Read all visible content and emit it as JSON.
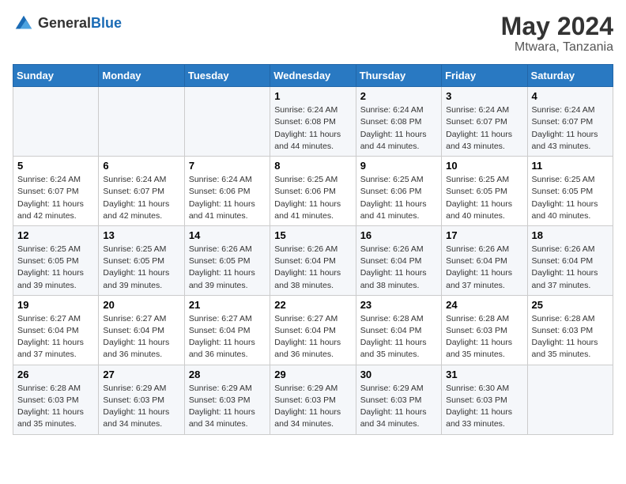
{
  "header": {
    "logo_general": "General",
    "logo_blue": "Blue",
    "main_title": "May 2024",
    "sub_title": "Mtwara, Tanzania"
  },
  "days_of_week": [
    "Sunday",
    "Monday",
    "Tuesday",
    "Wednesday",
    "Thursday",
    "Friday",
    "Saturday"
  ],
  "weeks": [
    [
      {
        "day": "",
        "sunrise": "",
        "sunset": "",
        "daylight": ""
      },
      {
        "day": "",
        "sunrise": "",
        "sunset": "",
        "daylight": ""
      },
      {
        "day": "",
        "sunrise": "",
        "sunset": "",
        "daylight": ""
      },
      {
        "day": "1",
        "sunrise": "Sunrise: 6:24 AM",
        "sunset": "Sunset: 6:08 PM",
        "daylight": "Daylight: 11 hours and 44 minutes."
      },
      {
        "day": "2",
        "sunrise": "Sunrise: 6:24 AM",
        "sunset": "Sunset: 6:08 PM",
        "daylight": "Daylight: 11 hours and 44 minutes."
      },
      {
        "day": "3",
        "sunrise": "Sunrise: 6:24 AM",
        "sunset": "Sunset: 6:07 PM",
        "daylight": "Daylight: 11 hours and 43 minutes."
      },
      {
        "day": "4",
        "sunrise": "Sunrise: 6:24 AM",
        "sunset": "Sunset: 6:07 PM",
        "daylight": "Daylight: 11 hours and 43 minutes."
      }
    ],
    [
      {
        "day": "5",
        "sunrise": "Sunrise: 6:24 AM",
        "sunset": "Sunset: 6:07 PM",
        "daylight": "Daylight: 11 hours and 42 minutes."
      },
      {
        "day": "6",
        "sunrise": "Sunrise: 6:24 AM",
        "sunset": "Sunset: 6:07 PM",
        "daylight": "Daylight: 11 hours and 42 minutes."
      },
      {
        "day": "7",
        "sunrise": "Sunrise: 6:24 AM",
        "sunset": "Sunset: 6:06 PM",
        "daylight": "Daylight: 11 hours and 41 minutes."
      },
      {
        "day": "8",
        "sunrise": "Sunrise: 6:25 AM",
        "sunset": "Sunset: 6:06 PM",
        "daylight": "Daylight: 11 hours and 41 minutes."
      },
      {
        "day": "9",
        "sunrise": "Sunrise: 6:25 AM",
        "sunset": "Sunset: 6:06 PM",
        "daylight": "Daylight: 11 hours and 41 minutes."
      },
      {
        "day": "10",
        "sunrise": "Sunrise: 6:25 AM",
        "sunset": "Sunset: 6:05 PM",
        "daylight": "Daylight: 11 hours and 40 minutes."
      },
      {
        "day": "11",
        "sunrise": "Sunrise: 6:25 AM",
        "sunset": "Sunset: 6:05 PM",
        "daylight": "Daylight: 11 hours and 40 minutes."
      }
    ],
    [
      {
        "day": "12",
        "sunrise": "Sunrise: 6:25 AM",
        "sunset": "Sunset: 6:05 PM",
        "daylight": "Daylight: 11 hours and 39 minutes."
      },
      {
        "day": "13",
        "sunrise": "Sunrise: 6:25 AM",
        "sunset": "Sunset: 6:05 PM",
        "daylight": "Daylight: 11 hours and 39 minutes."
      },
      {
        "day": "14",
        "sunrise": "Sunrise: 6:26 AM",
        "sunset": "Sunset: 6:05 PM",
        "daylight": "Daylight: 11 hours and 39 minutes."
      },
      {
        "day": "15",
        "sunrise": "Sunrise: 6:26 AM",
        "sunset": "Sunset: 6:04 PM",
        "daylight": "Daylight: 11 hours and 38 minutes."
      },
      {
        "day": "16",
        "sunrise": "Sunrise: 6:26 AM",
        "sunset": "Sunset: 6:04 PM",
        "daylight": "Daylight: 11 hours and 38 minutes."
      },
      {
        "day": "17",
        "sunrise": "Sunrise: 6:26 AM",
        "sunset": "Sunset: 6:04 PM",
        "daylight": "Daylight: 11 hours and 37 minutes."
      },
      {
        "day": "18",
        "sunrise": "Sunrise: 6:26 AM",
        "sunset": "Sunset: 6:04 PM",
        "daylight": "Daylight: 11 hours and 37 minutes."
      }
    ],
    [
      {
        "day": "19",
        "sunrise": "Sunrise: 6:27 AM",
        "sunset": "Sunset: 6:04 PM",
        "daylight": "Daylight: 11 hours and 37 minutes."
      },
      {
        "day": "20",
        "sunrise": "Sunrise: 6:27 AM",
        "sunset": "Sunset: 6:04 PM",
        "daylight": "Daylight: 11 hours and 36 minutes."
      },
      {
        "day": "21",
        "sunrise": "Sunrise: 6:27 AM",
        "sunset": "Sunset: 6:04 PM",
        "daylight": "Daylight: 11 hours and 36 minutes."
      },
      {
        "day": "22",
        "sunrise": "Sunrise: 6:27 AM",
        "sunset": "Sunset: 6:04 PM",
        "daylight": "Daylight: 11 hours and 36 minutes."
      },
      {
        "day": "23",
        "sunrise": "Sunrise: 6:28 AM",
        "sunset": "Sunset: 6:04 PM",
        "daylight": "Daylight: 11 hours and 35 minutes."
      },
      {
        "day": "24",
        "sunrise": "Sunrise: 6:28 AM",
        "sunset": "Sunset: 6:03 PM",
        "daylight": "Daylight: 11 hours and 35 minutes."
      },
      {
        "day": "25",
        "sunrise": "Sunrise: 6:28 AM",
        "sunset": "Sunset: 6:03 PM",
        "daylight": "Daylight: 11 hours and 35 minutes."
      }
    ],
    [
      {
        "day": "26",
        "sunrise": "Sunrise: 6:28 AM",
        "sunset": "Sunset: 6:03 PM",
        "daylight": "Daylight: 11 hours and 35 minutes."
      },
      {
        "day": "27",
        "sunrise": "Sunrise: 6:29 AM",
        "sunset": "Sunset: 6:03 PM",
        "daylight": "Daylight: 11 hours and 34 minutes."
      },
      {
        "day": "28",
        "sunrise": "Sunrise: 6:29 AM",
        "sunset": "Sunset: 6:03 PM",
        "daylight": "Daylight: 11 hours and 34 minutes."
      },
      {
        "day": "29",
        "sunrise": "Sunrise: 6:29 AM",
        "sunset": "Sunset: 6:03 PM",
        "daylight": "Daylight: 11 hours and 34 minutes."
      },
      {
        "day": "30",
        "sunrise": "Sunrise: 6:29 AM",
        "sunset": "Sunset: 6:03 PM",
        "daylight": "Daylight: 11 hours and 34 minutes."
      },
      {
        "day": "31",
        "sunrise": "Sunrise: 6:30 AM",
        "sunset": "Sunset: 6:03 PM",
        "daylight": "Daylight: 11 hours and 33 minutes."
      },
      {
        "day": "",
        "sunrise": "",
        "sunset": "",
        "daylight": ""
      }
    ]
  ]
}
